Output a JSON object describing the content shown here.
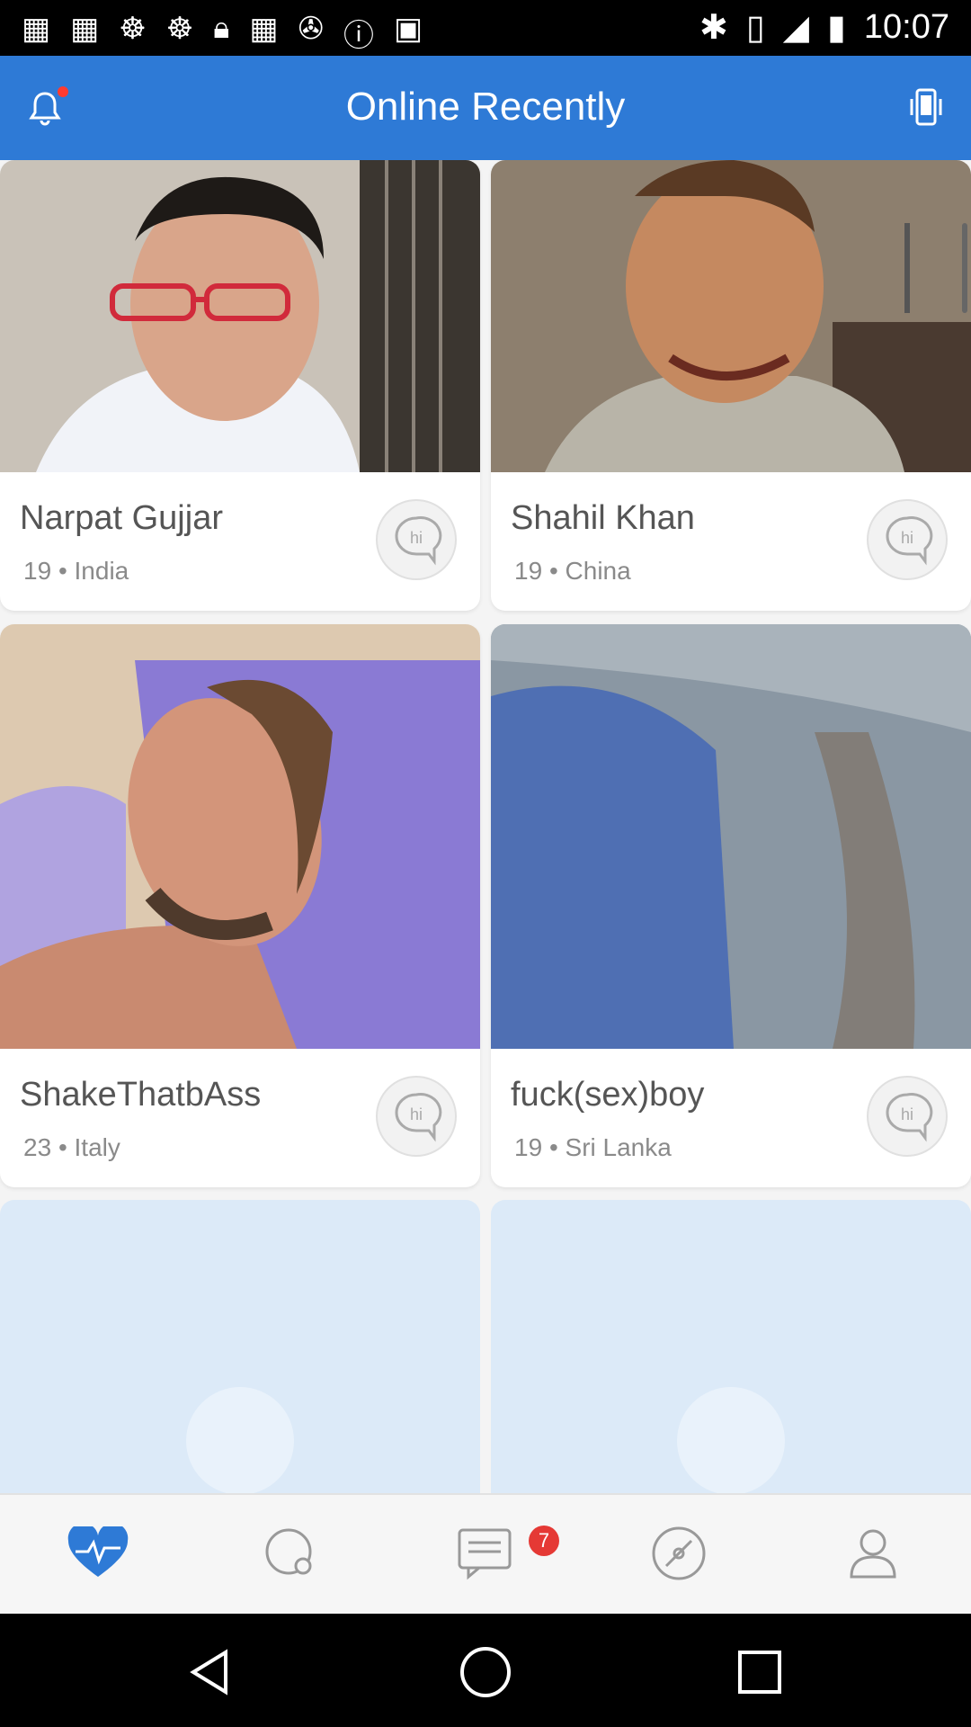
{
  "status_bar": {
    "time": "10:07",
    "icons": [
      "grid-icon",
      "grid-icon",
      "swirl-icon",
      "swirl-icon",
      "lock-icon",
      "grid-icon",
      "satellite-icon",
      "info-icon",
      "android-icon",
      "bluetooth-icon",
      "vibrate-icon",
      "no-signal-icon",
      "battery-icon"
    ]
  },
  "header": {
    "title": "Online Recently"
  },
  "cards": [
    {
      "name": "Narpat Gujjar",
      "age": "19",
      "country": "India",
      "hi_label": "hi"
    },
    {
      "name": "Shahil Khan",
      "age": "19",
      "country": "China",
      "hi_label": "hi"
    },
    {
      "name": "ShakeThatbAss",
      "age": "23",
      "country": "Italy",
      "hi_label": "hi"
    },
    {
      "name": "fuck(sex)boy",
      "age": "19",
      "country": "Sri Lanka",
      "hi_label": "hi"
    }
  ],
  "meta_separator": "•",
  "tabbar": {
    "tabs": [
      "heartbeat-icon",
      "chat-bubble-icon",
      "messages-icon",
      "compass-icon",
      "profile-icon"
    ],
    "messages_badge": "7",
    "active_color": "#2e7ad6"
  },
  "colors": {
    "accent": "#2e7ad6",
    "placeholder": "#dceaf8"
  }
}
